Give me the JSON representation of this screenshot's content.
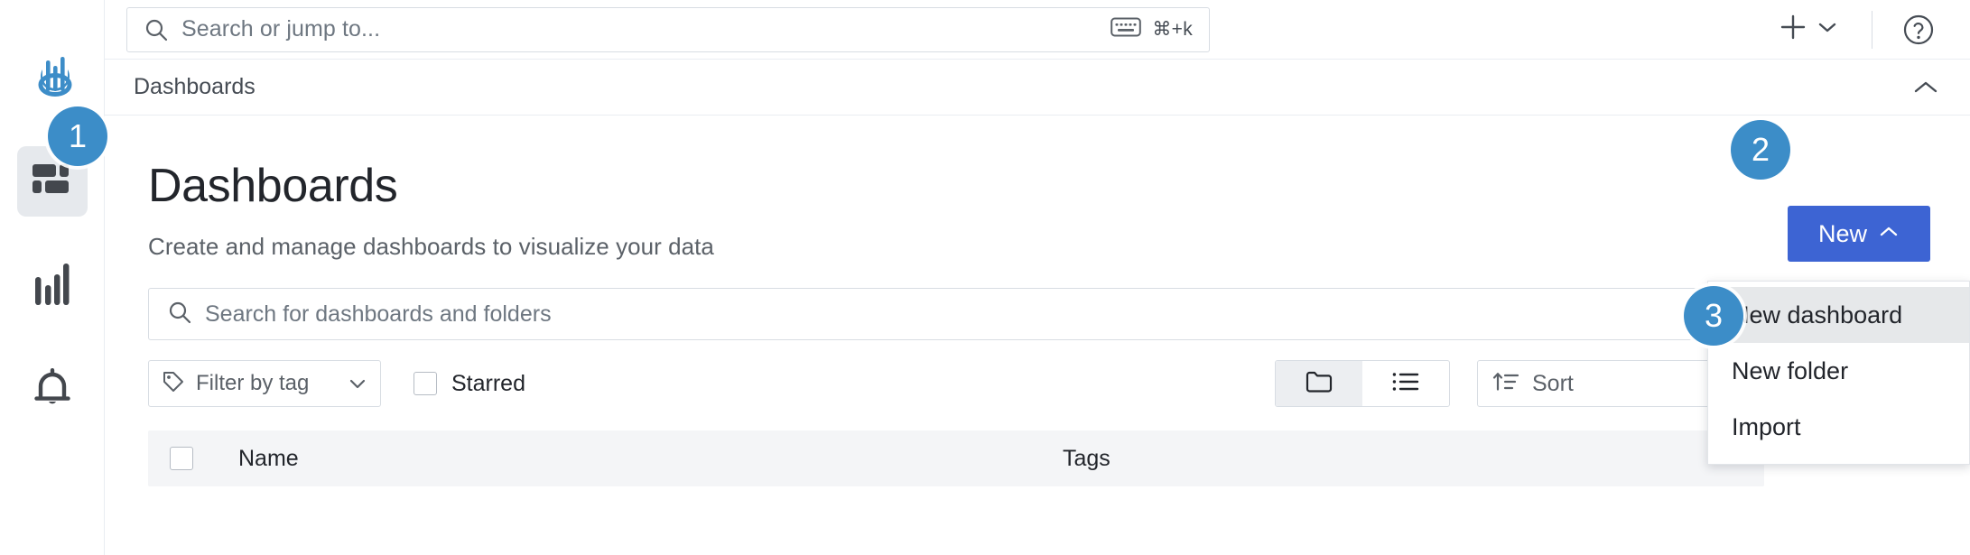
{
  "app": {
    "logo_icon": "mackerel-logo-icon",
    "accent_blue": "#3d64d3",
    "badge_blue": "#3c8dc8"
  },
  "sidebar": {
    "items": [
      {
        "id": "dashboards",
        "icon": "dashboard-grid-icon",
        "active": true
      },
      {
        "id": "explore",
        "icon": "bar-chart-icon",
        "active": false
      },
      {
        "id": "alerts",
        "icon": "bell-icon",
        "active": false
      }
    ]
  },
  "topbar": {
    "search": {
      "icon": "search-icon",
      "placeholder": "Search or jump to...",
      "value": "",
      "kbd_icon": "keyboard-icon",
      "shortcut": "⌘+k"
    },
    "add_button": {
      "icon": "plus-icon",
      "caret": "chevron-down-icon"
    },
    "help_button": {
      "icon": "help-circle-icon"
    }
  },
  "breadcrumb": {
    "items": [
      "Dashboards"
    ],
    "collapse_icon": "chevron-up-icon"
  },
  "page": {
    "title": "Dashboards",
    "subtitle": "Create and manage dashboards to visualize your data",
    "search": {
      "icon": "search-icon",
      "placeholder": "Search for dashboards and folders",
      "value": ""
    },
    "toolbar": {
      "tag_filter": {
        "icon": "tag-icon",
        "label": "Filter by tag",
        "caret": "chevron-down-icon"
      },
      "starred": {
        "label": "Starred",
        "checked": false
      },
      "view_toggle": [
        {
          "id": "folder-view",
          "icon": "folder-icon",
          "active": true
        },
        {
          "id": "list-view",
          "icon": "list-icon",
          "active": false
        }
      ],
      "sort": {
        "icon": "sort-ascending-icon",
        "label": "Sort"
      }
    },
    "table": {
      "columns": [
        "Name",
        "Tags"
      ],
      "select_all_checked": false,
      "rows": []
    }
  },
  "new_button": {
    "label": "New",
    "caret": "chevron-up-icon"
  },
  "dropdown": {
    "items": [
      {
        "label": "New dashboard",
        "hovered": true
      },
      {
        "label": "New folder",
        "hovered": false
      },
      {
        "label": "Import",
        "hovered": false
      }
    ]
  },
  "step_badges": [
    {
      "id": "1",
      "label": "1"
    },
    {
      "id": "2",
      "label": "2"
    },
    {
      "id": "3",
      "label": "3"
    }
  ]
}
